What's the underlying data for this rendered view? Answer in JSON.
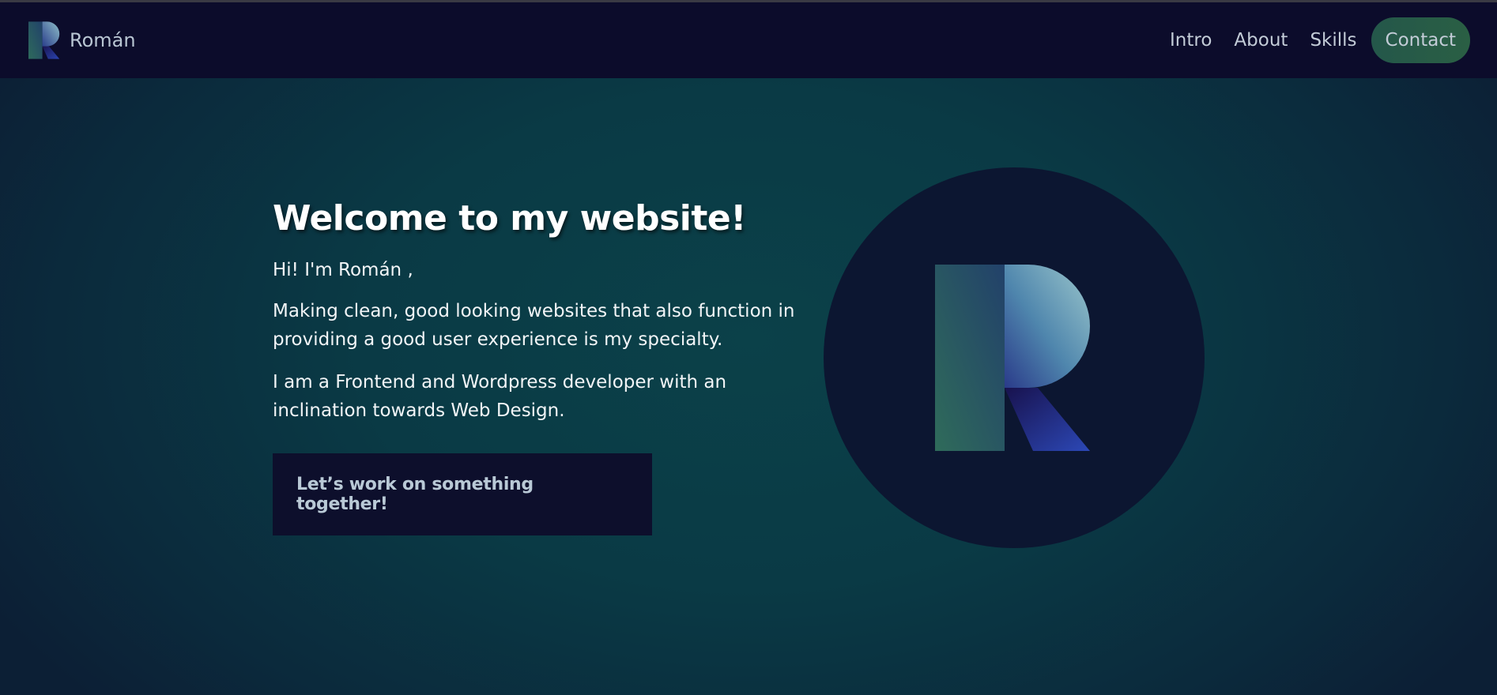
{
  "brand": {
    "name": "Román",
    "logo_icon": "r-logo-icon"
  },
  "nav": {
    "items": [
      {
        "label": "Intro"
      },
      {
        "label": "About"
      },
      {
        "label": "Skills"
      }
    ],
    "contact_label": "Contact"
  },
  "hero": {
    "title": "Welcome to my website!",
    "greeting": "Hi! I'm Román ,",
    "paragraph1": "Making clean, good looking websites that also function in providing a good user experience is my specialty.",
    "paragraph2": "I am a Frontend and Wordpress developer with an inclination towards Web Design.",
    "cta_label": "Let’s work on something together!",
    "logo_icon": "r-logo-icon"
  },
  "colors": {
    "navbar_bg": "#0c0c2b",
    "hero_bg": "#0b4149",
    "contact_bg": "#2a5f44",
    "cta_bg": "#0d0f2c",
    "circle_bg": "#0c1631"
  }
}
